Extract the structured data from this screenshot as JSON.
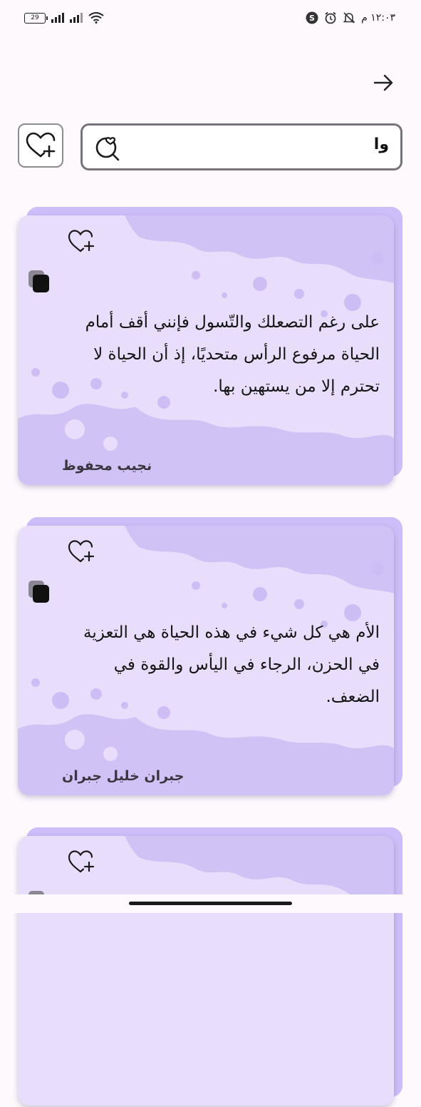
{
  "status_bar": {
    "battery": "29",
    "time": "١٢:٠٣ م"
  },
  "header": {
    "back_icon": "arrow-right-icon"
  },
  "search": {
    "value": "وا",
    "icon": "search-heart-icon"
  },
  "favorite_button": {
    "icon": "heart-plus-icon"
  },
  "colors": {
    "card_bg": "#e8defc",
    "card_back": "#cdbdf8",
    "splash": "#cdbdf5",
    "background": "#fdf9fd"
  },
  "quotes": [
    {
      "text": "على رغم التصعلك والتّسول فإنني أقف أمام الحياة مرفوع الرأس متحديًا، إذ أن الحياة لا تحترم إلا من يستهين بها.",
      "author": "نجيب محفوظ"
    },
    {
      "text": "الأم هي كل شيء في هذه الحياة هي التعزية في الحزن، الرجاء في اليأس والقوة في الضعف.",
      "author": "جبران خليل جبران"
    },
    {
      "text": "",
      "author": ""
    }
  ]
}
